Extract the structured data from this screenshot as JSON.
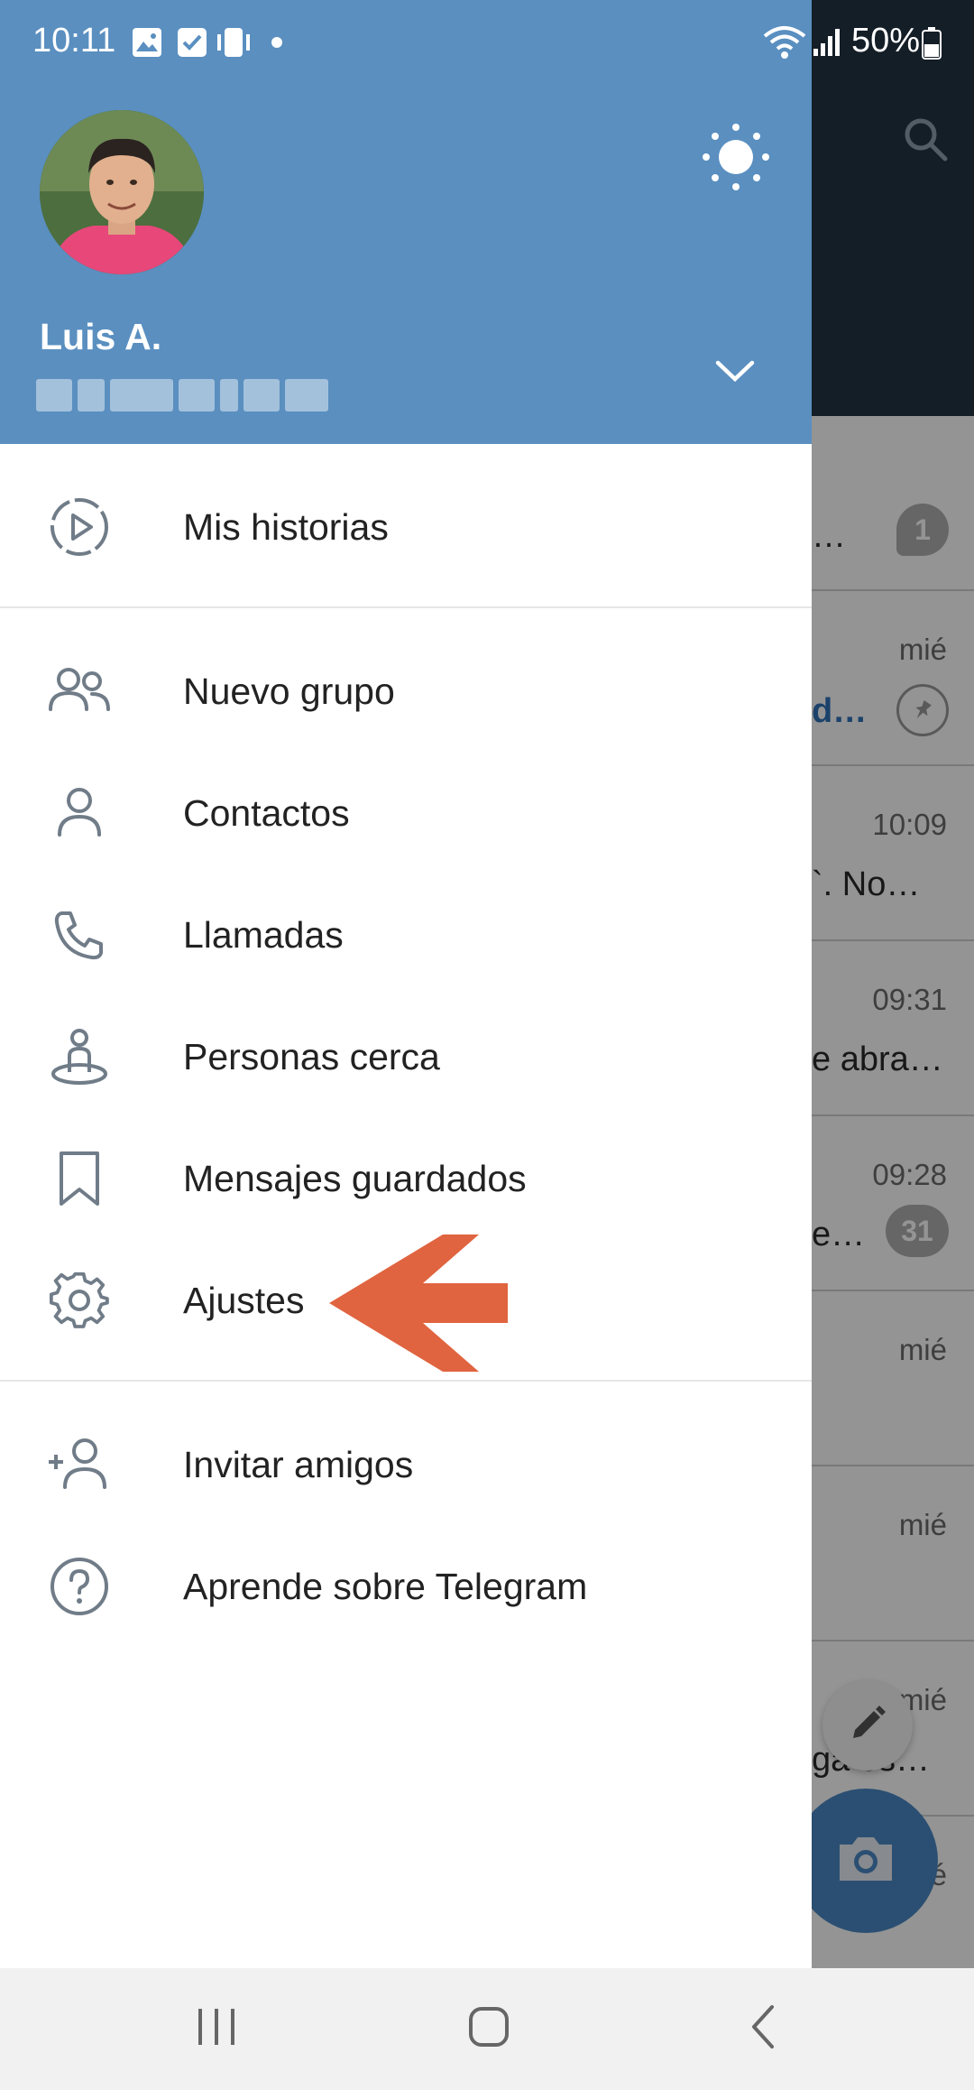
{
  "status_bar": {
    "time": "10:11",
    "battery": "50%"
  },
  "drawer": {
    "user": {
      "name": "Luis A."
    },
    "menu": {
      "stories": "Mis historias",
      "new_group": "Nuevo grupo",
      "contacts": "Contactos",
      "calls": "Llamadas",
      "nearby": "Personas cerca",
      "saved": "Mensajes guardados",
      "settings": "Ajustes",
      "invite": "Invitar amigos",
      "learn": "Aprende sobre Telegram"
    }
  },
  "background_chats": [
    {
      "time": "",
      "preview": "…",
      "badge": "1"
    },
    {
      "time": "mié",
      "preview": "d…",
      "pinned": true
    },
    {
      "time": "10:09",
      "preview": "`. No…"
    },
    {
      "time": "09:31",
      "preview": "e abra…"
    },
    {
      "time": "09:28",
      "preview": "e…",
      "badge": "31"
    },
    {
      "time": "mié",
      "preview": ""
    },
    {
      "time": "mié",
      "preview": ""
    },
    {
      "time": "mié",
      "preview": "ga es…"
    },
    {
      "time": "é",
      "preview": ""
    }
  ],
  "colors": {
    "header": "#5a8fc0",
    "accent_arrow": "#e0643f",
    "chat_header": "#233444"
  }
}
